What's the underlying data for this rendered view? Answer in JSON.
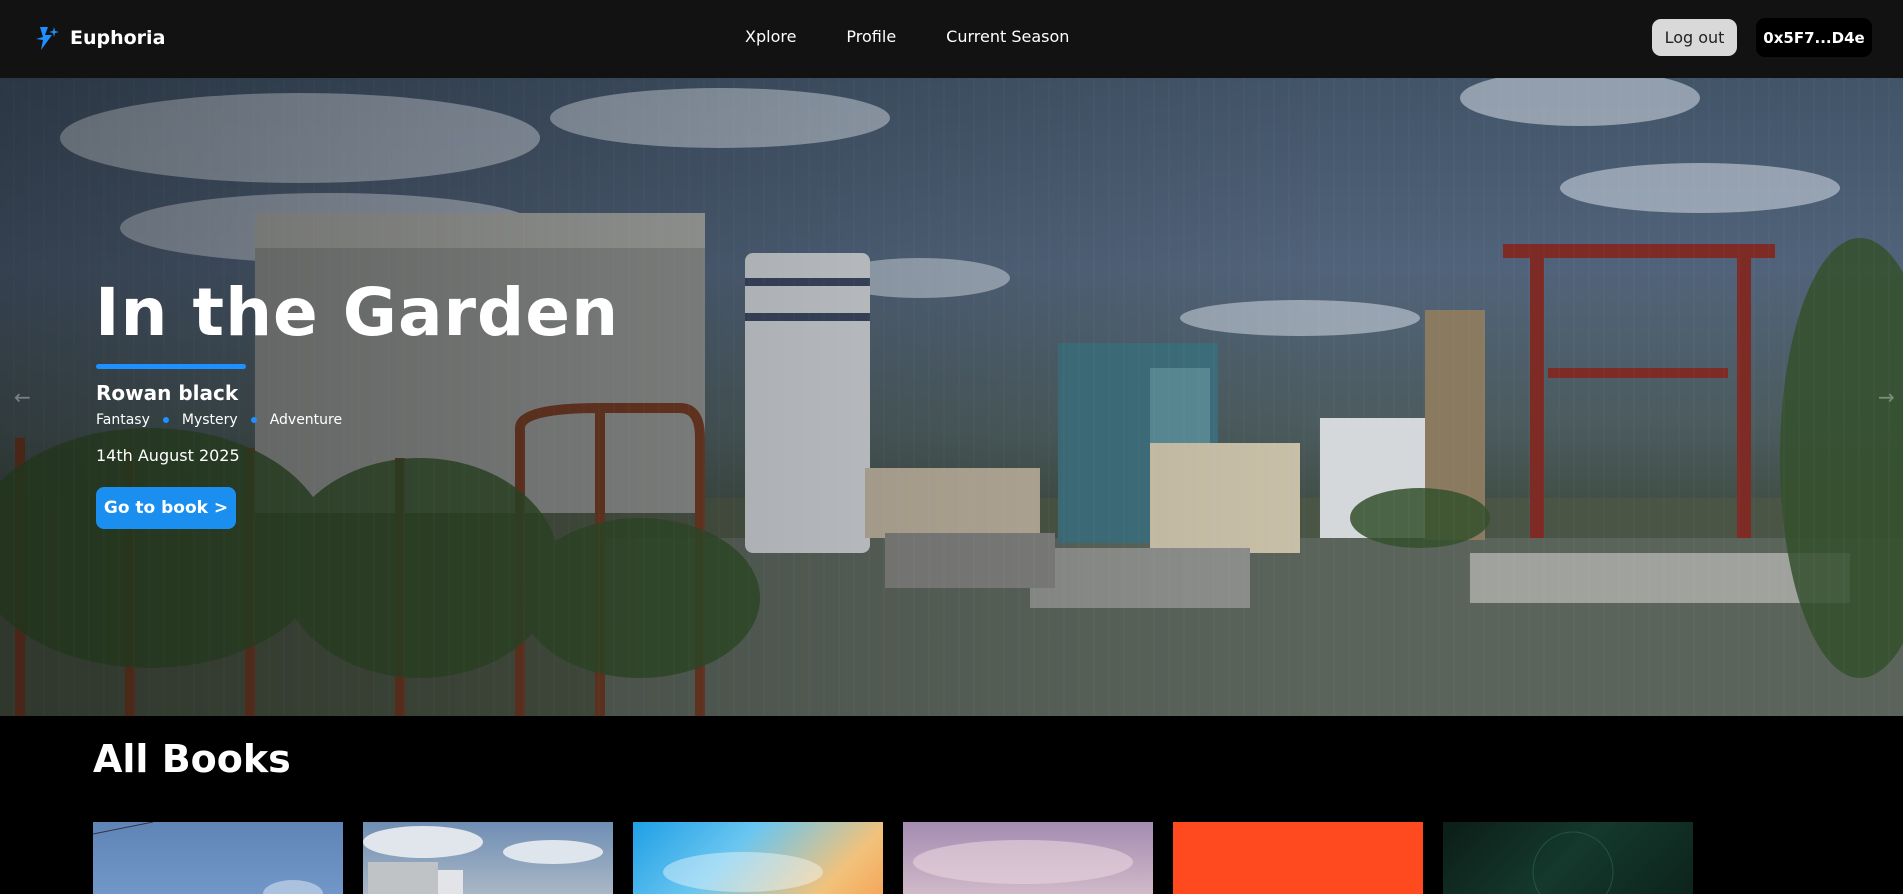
{
  "header": {
    "logo_text": "Euphoria",
    "logo_icon": "lightning-star-icon",
    "nav": [
      "Xplore",
      "Profile",
      "Current Season"
    ],
    "logout_label": "Log out",
    "wallet_label": "0x5F7...D4e"
  },
  "hero": {
    "title": "In the Garden",
    "author": "Rowan black",
    "genres": [
      "Fantasy",
      "Mystery",
      "Adventure"
    ],
    "date": "14th August 2025",
    "cta_label": "Go to book >",
    "prev_icon": "arrow-left-icon",
    "next_icon": "arrow-right-icon",
    "accent_color": "#1e90ff"
  },
  "all_books": {
    "title": "All Books",
    "cover_colors": [
      "#6d8fbd",
      "#8fa6bf",
      "#4ab5e8",
      "#b7a3c3",
      "#ff4a1f",
      "#0e2a22"
    ]
  }
}
